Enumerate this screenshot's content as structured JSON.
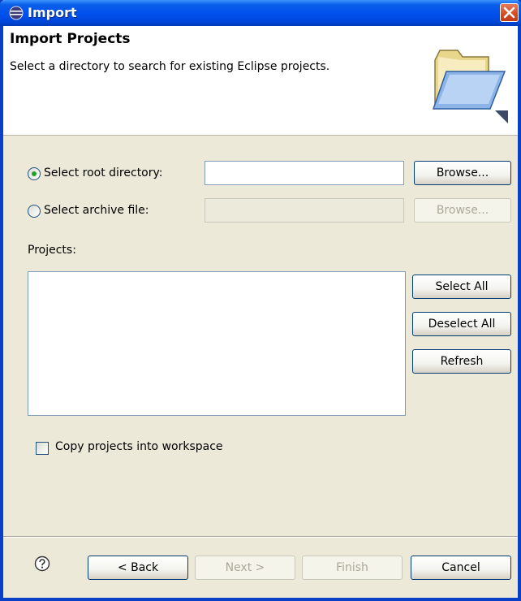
{
  "window": {
    "title": "Import",
    "close_icon": "close-icon"
  },
  "banner": {
    "title": "Import Projects",
    "description": "Select a directory to search for existing Eclipse projects.",
    "icon": "folder-open-icon"
  },
  "source": {
    "root_option": {
      "label": "Select root directory:",
      "selected": true
    },
    "root_value": "",
    "browse_label": "Browse...",
    "archive_option": {
      "label": "Select archive file:",
      "selected": false
    },
    "archive_value": "",
    "archive_browse_label": "Browse..."
  },
  "projects": {
    "label": "Projects:",
    "items": [],
    "select_all_label": "Select All",
    "deselect_all_label": "Deselect All",
    "refresh_label": "Refresh"
  },
  "copy_option": {
    "label": "Copy projects into workspace",
    "checked": false
  },
  "footer": {
    "help_icon": "help-icon",
    "back_label": "< Back",
    "next_label": "Next >",
    "finish_label": "Finish",
    "cancel_label": "Cancel"
  },
  "colors": {
    "titlebar": "#0050ee",
    "dialog_bg": "#ece9d8",
    "radio_dot": "#21a121"
  }
}
